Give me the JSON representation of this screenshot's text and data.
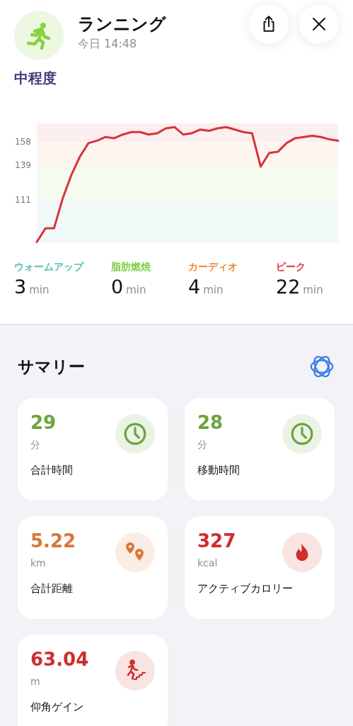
{
  "header": {
    "title": "ランニング",
    "subtitle": "今日 14:48",
    "buttons": [
      {
        "kind": "share"
      },
      {
        "kind": "close"
      }
    ]
  },
  "intensity": "中程度",
  "chart": {
    "chart_data": {
      "type": "line",
      "ylim": [
        76,
        173
      ],
      "yticks": [
        111,
        139,
        158
      ],
      "categories": [
        null,
        null,
        null,
        null,
        null,
        null,
        null,
        null,
        null,
        null,
        null,
        null,
        null,
        null,
        null,
        null,
        null,
        null,
        null,
        null,
        null,
        null,
        null,
        null,
        null,
        null,
        null,
        null,
        null,
        null,
        null,
        null,
        null,
        null,
        null,
        null
      ],
      "series": [
        {
          "color": "#d8343d",
          "values": [
            77,
            88,
            88,
            112,
            131,
            146,
            157,
            159,
            162,
            161,
            164,
            166,
            166,
            164,
            165,
            169,
            170,
            164,
            165,
            168,
            167,
            169,
            170,
            168,
            166,
            165,
            138,
            149,
            150,
            157,
            161,
            162,
            163,
            162,
            160,
            159
          ]
        }
      ]
    }
  },
  "zones": [
    {
      "name": "ウォームアップ",
      "value": "3",
      "unit": "min",
      "color": "#5bbdb3"
    },
    {
      "name": "脂肪燃焼",
      "value": "0",
      "unit": "min",
      "color": "#7cce45"
    },
    {
      "name": "カーディオ",
      "value": "4",
      "unit": "min",
      "color": "#ea8a3c"
    },
    {
      "name": "ピーク",
      "value": "22",
      "unit": "min",
      "color": "#d8343d"
    }
  ],
  "summary": {
    "title": "サマリー",
    "cards": [
      {
        "value": "29",
        "unit": "分",
        "label": "合計時間",
        "kind": "clock",
        "color": "#6aa53f"
      },
      {
        "value": "28",
        "unit": "分",
        "label": "移動時間",
        "kind": "clock",
        "color": "#6aa53f"
      },
      {
        "value": "5.22",
        "unit": "km",
        "label": "合計距離",
        "kind": "pins",
        "color": "#d9773a"
      },
      {
        "value": "327",
        "unit": "kcal",
        "label": "アクティブカロリー",
        "kind": "flame",
        "color": "#cf2d2d"
      },
      {
        "value": "63.04",
        "unit": "m",
        "label": "仰角ゲイン",
        "kind": "stairs",
        "color": "#cf2d2d"
      }
    ]
  }
}
